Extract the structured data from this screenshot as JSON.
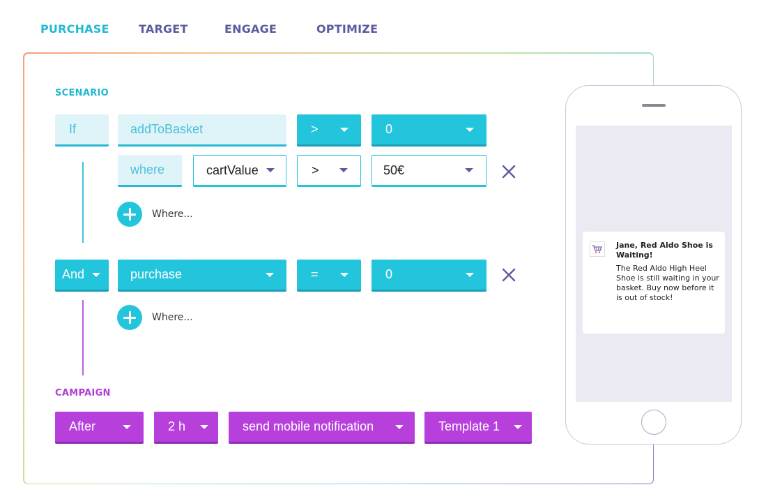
{
  "tabs": [
    {
      "label": "PURCHASE",
      "active": true
    },
    {
      "label": "TARGET",
      "active": false
    },
    {
      "label": "ENGAGE",
      "active": false
    },
    {
      "label": "OPTIMIZE",
      "active": false
    }
  ],
  "scenario": {
    "label": "SCENARIO",
    "rule1": {
      "keyword": "If",
      "event": "addToBasket",
      "operator": ">",
      "value": "0",
      "where": {
        "keyword": "where",
        "property": "cartValue",
        "operator": ">",
        "value": "50€"
      },
      "add_where": "Where..."
    },
    "rule2": {
      "keyword": "And",
      "event": "purchase",
      "operator": "=",
      "value": "0",
      "add_where": "Where..."
    }
  },
  "campaign": {
    "label": "CAMPAIGN",
    "timing": "After",
    "delay": "2 h",
    "action": "send mobile notification",
    "template": "Template 1"
  },
  "phone": {
    "notification": {
      "title": "Jane, Red Aldo Shoe is Waiting!",
      "body": "The Red Aldo High Heel Shoe is still waiting in your basket. Buy now before it is out of stock!",
      "icon": "shopping-cart-icon"
    }
  },
  "colors": {
    "tab_active": "#25b8d3",
    "tab_inactive": "#5b5a9e",
    "cyan": "#23c5dc",
    "purple": "#b73fdc",
    "remove_icon": "#5b5a9e"
  }
}
